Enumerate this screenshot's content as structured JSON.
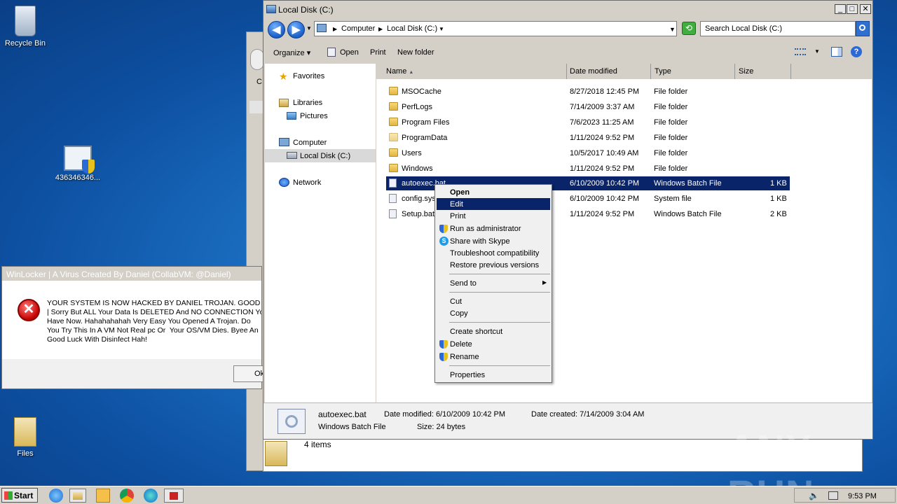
{
  "desktop": {
    "icons": [
      {
        "label": "Recycle Bin",
        "icon": "recycle-bin-icon"
      },
      {
        "label": "436346346...",
        "icon": "exe-file-icon"
      },
      {
        "label": "Files",
        "icon": "folder-icon"
      }
    ]
  },
  "dialog": {
    "title": "WinLocker | A Virus Created By Daniel (CollabVM: @Daniel)",
    "message_lines": [
      "YOUR SYSTEM IS NOW HACKED BY DANIEL TROJAN. GOOD LUC",
      "| Sorry But ALL Your Data Is DELETED And NO CONNECTION Yo",
      "Have Now. Hahahahahah Very Easy You Opened A Trojan. Do",
      "You Try This In A VM Not Real pc Or  Your OS/VM Dies. Byee An",
      "Good Luck With Disinfect Hah!"
    ],
    "ok_label": "Ok"
  },
  "back_window": {
    "left_letter": "C",
    "status": "4 items"
  },
  "explorer": {
    "title": "Local Disk (C:)",
    "breadcrumb": [
      "Computer",
      "Local Disk (C:)"
    ],
    "search_placeholder": "Search Local Disk (C:)",
    "toolbar": {
      "organize": "Organize",
      "open": "Open",
      "print": "Print",
      "new_folder": "New folder"
    },
    "nav": {
      "favorites": "Favorites",
      "libraries": "Libraries",
      "pictures": "Pictures",
      "computer": "Computer",
      "local_disk": "Local Disk (C:)",
      "network": "Network"
    },
    "columns": {
      "name": "Name",
      "date": "Date modified",
      "type": "Type",
      "size": "Size"
    },
    "rows": [
      {
        "name": "MSOCache",
        "date": "8/27/2018 12:45 PM",
        "type": "File folder",
        "size": ""
      },
      {
        "name": "PerfLogs",
        "date": "7/14/2009 3:37 AM",
        "type": "File folder",
        "size": ""
      },
      {
        "name": "Program Files",
        "date": "7/6/2023 11:25 AM",
        "type": "File folder",
        "size": ""
      },
      {
        "name": "ProgramData",
        "date": "1/11/2024 9:52 PM",
        "type": "File folder",
        "size": ""
      },
      {
        "name": "Users",
        "date": "10/5/2017 10:49 AM",
        "type": "File folder",
        "size": ""
      },
      {
        "name": "Windows",
        "date": "1/11/2024 9:52 PM",
        "type": "File folder",
        "size": ""
      },
      {
        "name": "autoexec.bat",
        "date": "6/10/2009 10:42 PM",
        "type": "Windows Batch File",
        "size": "1 KB"
      },
      {
        "name": "config.sys",
        "date": "6/10/2009 10:42 PM",
        "type": "System file",
        "size": "1 KB"
      },
      {
        "name": "Setup.bat",
        "date": "1/11/2024 9:52 PM",
        "type": "Windows Batch File",
        "size": "2 KB"
      }
    ],
    "details": {
      "filename": "autoexec.bat",
      "filetype": "Windows Batch File",
      "date_modified": "Date modified: 6/10/2009 10:42 PM",
      "size": "Size: 24 bytes",
      "date_created": "Date created: 7/14/2009 3:04 AM"
    }
  },
  "context_menu": {
    "items": [
      {
        "label": "Open"
      },
      {
        "label": "Edit"
      },
      {
        "label": "Print"
      },
      {
        "label": "Run as administrator"
      },
      {
        "label": "Share with Skype"
      },
      {
        "label": "Troubleshoot compatibility"
      },
      {
        "label": "Restore previous versions"
      },
      {
        "label": "Send to"
      },
      {
        "label": "Cut"
      },
      {
        "label": "Copy"
      },
      {
        "label": "Create shortcut"
      },
      {
        "label": "Delete"
      },
      {
        "label": "Rename"
      },
      {
        "label": "Properties"
      }
    ]
  },
  "taskbar": {
    "start": "Start",
    "clock": "9:53 PM"
  },
  "watermark": "ANY RUN"
}
